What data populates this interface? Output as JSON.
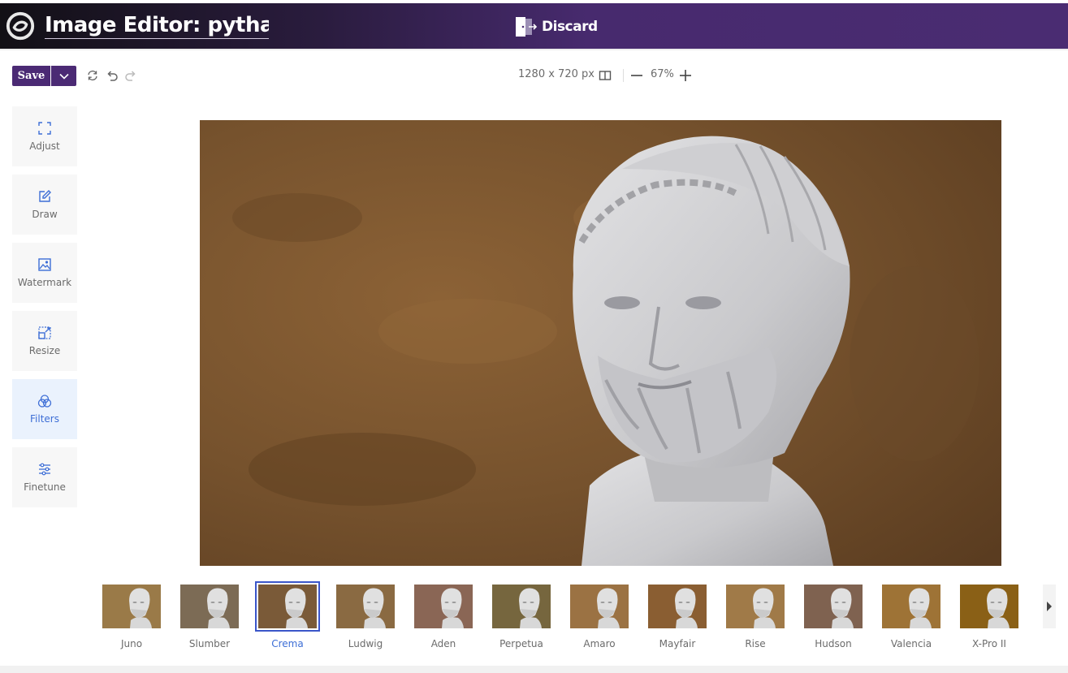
{
  "header": {
    "title": "Image Editor: pythag...",
    "discard_label": "Discard",
    "logo_icon": "app-logo-icon",
    "discard_icon": "door-exit-icon"
  },
  "toolbar": {
    "save_label": "Save",
    "dimensions": "1280 x 720 px",
    "zoom": "67%",
    "icons": [
      "reset-icon",
      "undo-icon",
      "redo-icon",
      "compare-icon",
      "zoom-out-icon",
      "zoom-in-icon"
    ]
  },
  "sidebar": {
    "items": [
      {
        "label": "Adjust",
        "icon": "crop-icon",
        "active": false
      },
      {
        "label": "Draw",
        "icon": "pencil-icon",
        "active": false
      },
      {
        "label": "Watermark",
        "icon": "watermark-icon",
        "active": false
      },
      {
        "label": "Resize",
        "icon": "resize-icon",
        "active": false
      },
      {
        "label": "Filters",
        "icon": "filters-icon",
        "active": true
      },
      {
        "label": "Finetune",
        "icon": "sliders-icon",
        "active": false
      }
    ]
  },
  "filters": {
    "selected": "Crema",
    "items": [
      {
        "label": "Juno",
        "tint": "#9a7a48"
      },
      {
        "label": "Slumber",
        "tint": "#7c6b55"
      },
      {
        "label": "Crema",
        "tint": "#7a5a38"
      },
      {
        "label": "Ludwig",
        "tint": "#8a6a42"
      },
      {
        "label": "Aden",
        "tint": "#8a6655"
      },
      {
        "label": "Perpetua",
        "tint": "#76663e"
      },
      {
        "label": "Amaro",
        "tint": "#9b7243"
      },
      {
        "label": "Mayfair",
        "tint": "#8a5e32"
      },
      {
        "label": "Rise",
        "tint": "#a07a48"
      },
      {
        "label": "Hudson",
        "tint": "#7f6250"
      },
      {
        "label": "Valencia",
        "tint": "#9e7336"
      },
      {
        "label": "X-Pro II",
        "tint": "#8a6016"
      }
    ]
  },
  "colors": {
    "brand": "#4b2a74",
    "accent": "#3d6ed6"
  }
}
